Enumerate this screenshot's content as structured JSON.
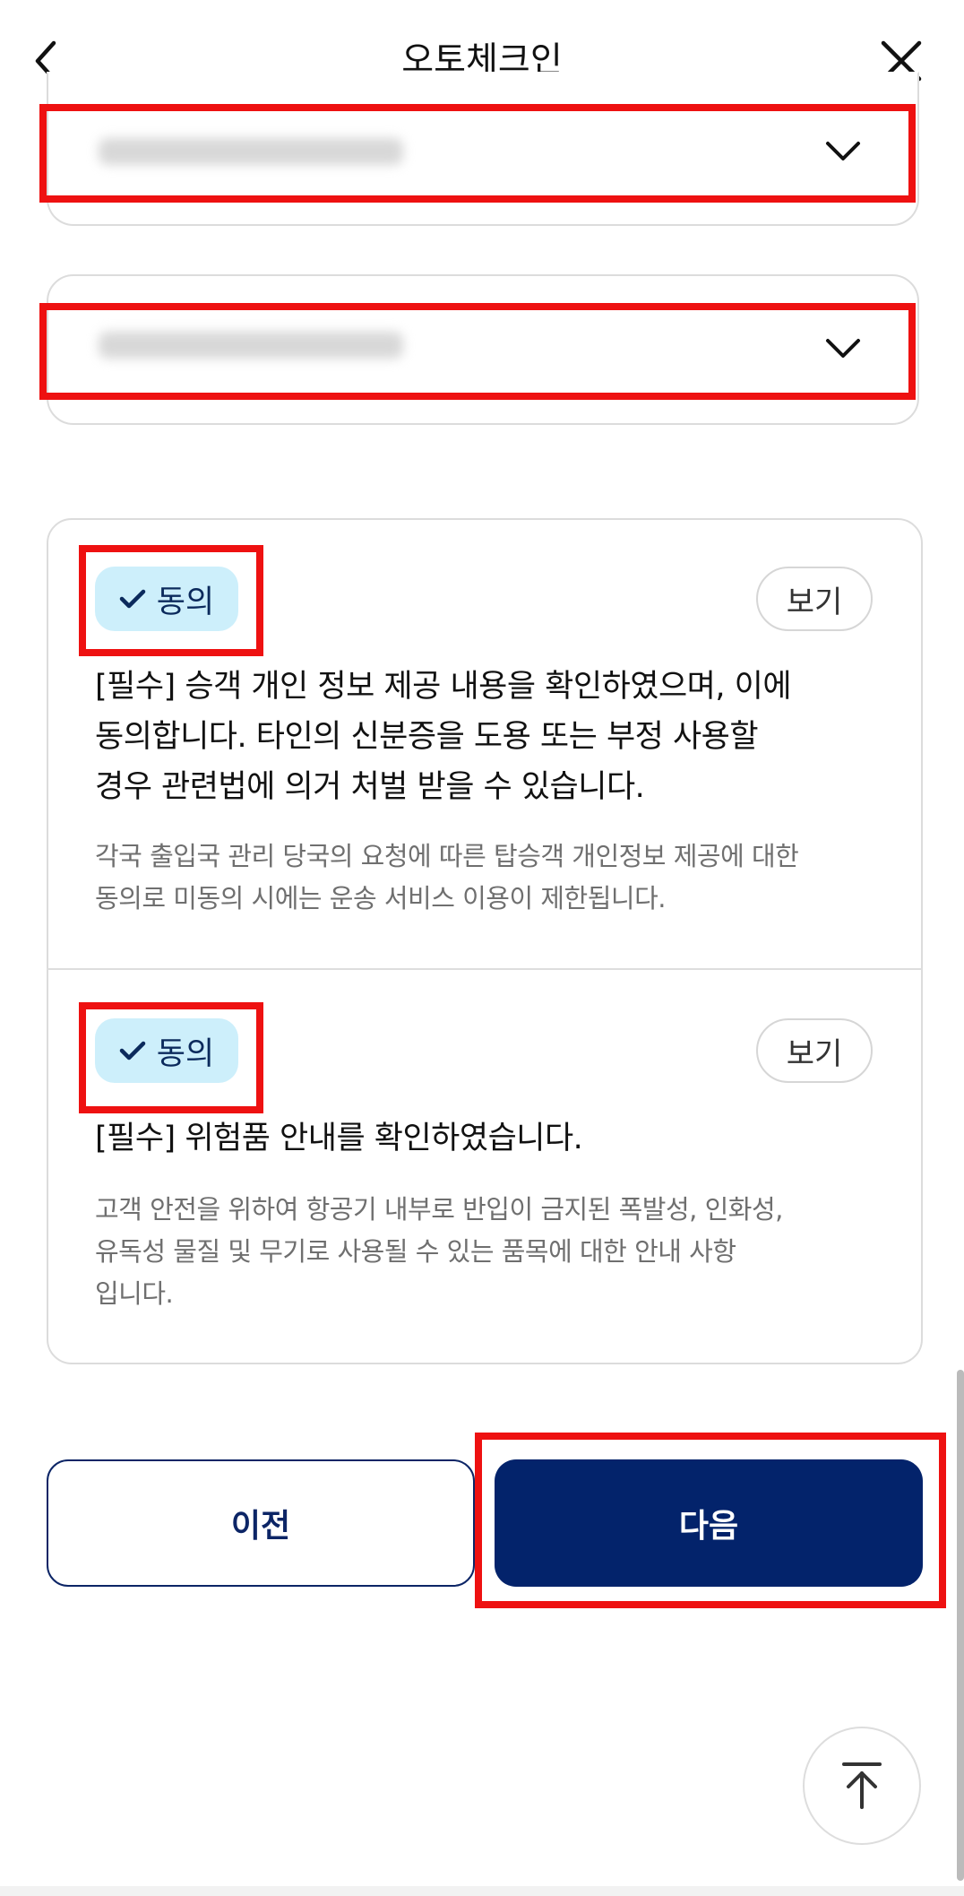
{
  "header": {
    "title": "오토체크인",
    "back_icon": "chevron-left-icon",
    "close_icon": "close-icon"
  },
  "passengers": [
    {
      "name_masked": "",
      "icon": "chevron-down-icon",
      "expanded": false
    },
    {
      "name_masked": "",
      "icon": "chevron-down-icon",
      "expanded": false
    }
  ],
  "consents": [
    {
      "chip_label": "동의",
      "chip_icon": "check-icon",
      "agreed": true,
      "view_label": "보기",
      "main_lines": [
        "[필수] 승객 개인 정보 제공 내용을 확인하였으며, 이에",
        "동의합니다. 타인의 신분증을 도용 또는 부정 사용할",
        "경우 관련법에 의거 처벌 받을 수 있습니다."
      ],
      "sub_lines": [
        "각국 출입국 관리 당국의 요청에 따른 탑승객 개인정보 제공에 대한",
        "동의로 미동의 시에는 운송 서비스 이용이 제한됩니다."
      ]
    },
    {
      "chip_label": "동의",
      "chip_icon": "check-icon",
      "agreed": true,
      "view_label": "보기",
      "main_lines": [
        "[필수] 위험품 안내를 확인하였습니다."
      ],
      "sub_lines": [
        "고객 안전을 위하여 항공기 내부로 반입이 금지된 폭발성, 인화성,",
        "유독성 물질 및 무기로 사용될 수 있는 품목에 대한 안내 사항",
        "입니다."
      ]
    }
  ],
  "actions": {
    "prev_label": "이전",
    "next_label": "다음"
  },
  "scroll_top_icon": "arrow-up-to-top-icon",
  "colors": {
    "primary": "#03236b",
    "chip_bg": "#cdeffb",
    "highlight": "#ee1111"
  }
}
